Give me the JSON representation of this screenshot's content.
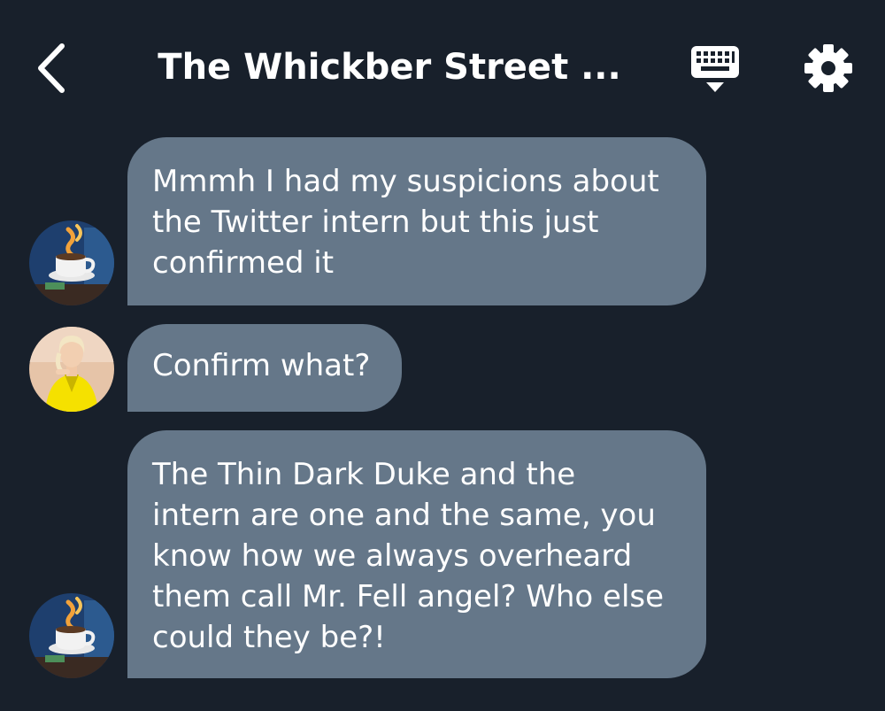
{
  "header": {
    "back_icon": "chevron-left-icon",
    "title": "The Whickber Street ...",
    "keyboard_icon": "keyboard-icon",
    "settings_icon": "gear-icon"
  },
  "messages": [
    {
      "sender_avatar": "coffee-shop-avatar",
      "text": "Mmmh I had my suspicions about\nthe Twitter intern but this just\nconfirmed it"
    },
    {
      "sender_avatar": "woman-yellow-jacket-avatar",
      "text": "Confirm what?"
    },
    {
      "sender_avatar": "coffee-shop-avatar",
      "text": "The Thin Dark Duke and the\nintern are one and the same, you\nknow how we always overheard\nthem call Mr. Fell angel? Who else\ncould they be?!"
    }
  ],
  "colors": {
    "background": "#18202b",
    "bubble": "#657789",
    "text": "#ffffff"
  }
}
